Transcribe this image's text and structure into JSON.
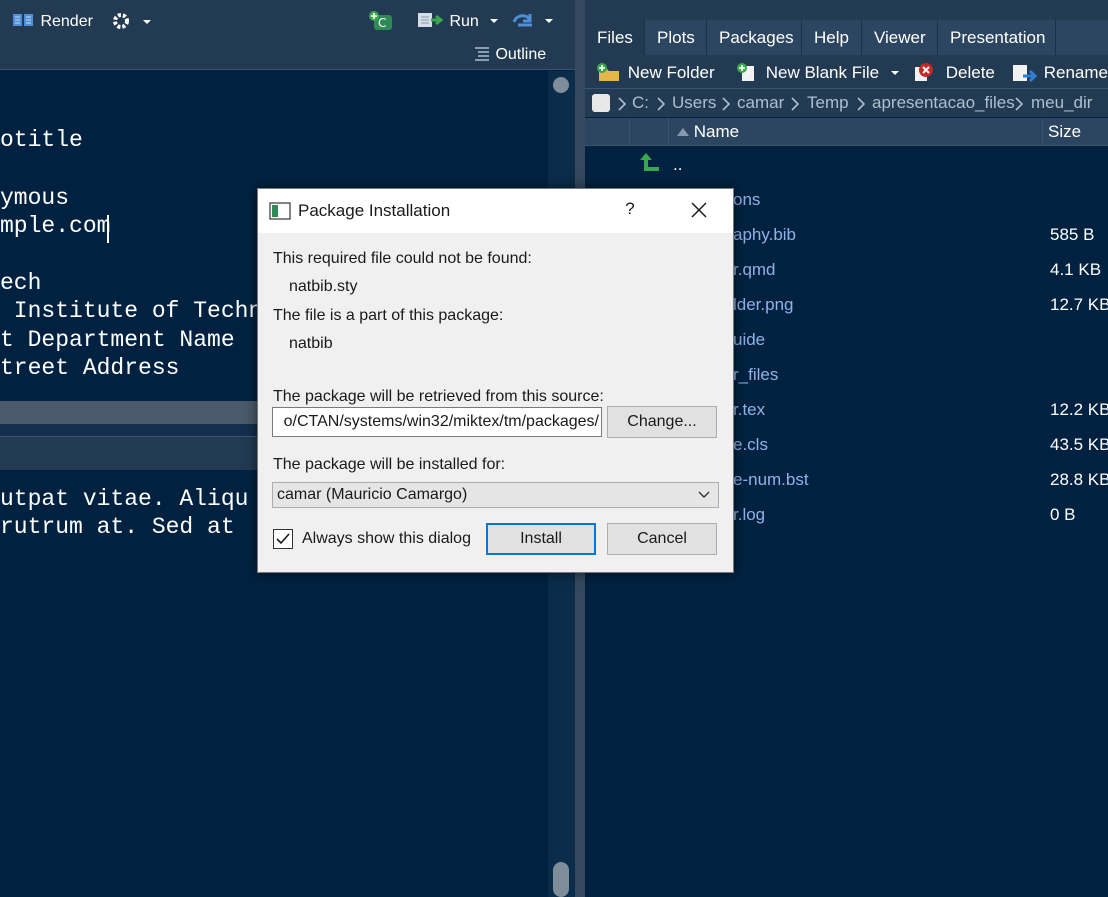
{
  "editor_toolbar": {
    "render_label": "Render",
    "run_label": "Run",
    "outline_label": "Outline"
  },
  "editor": {
    "lines": [
      "otitle",
      "ymous",
      "mple.com",
      "ech",
      " Institute of Techn",
      "t Department Name",
      "treet Address"
    ]
  },
  "console": {
    "lines": [
      "utpat vitae. Aliqu",
      "rutrum at. Sed at"
    ]
  },
  "right_tabs": [
    {
      "label": "Files",
      "active": true
    },
    {
      "label": "Plots"
    },
    {
      "label": "Packages"
    },
    {
      "label": "Help"
    },
    {
      "label": "Viewer"
    },
    {
      "label": "Presentation"
    }
  ],
  "files_toolbar": {
    "new_folder": "New Folder",
    "new_blank_file": "New Blank File",
    "delete": "Delete",
    "rename": "Rename"
  },
  "breadcrumb": [
    "C:",
    "Users",
    "camar",
    "Temp",
    "apresentacao_files",
    "meu_dir"
  ],
  "file_table": {
    "header_name": "Name",
    "header_size": "Size",
    "rows": [
      {
        "name": "..",
        "size": ""
      },
      {
        "name": "ons",
        "size": ""
      },
      {
        "name": "aphy.bib",
        "size": "585 B"
      },
      {
        "name": "r.qmd",
        "size": "4.1 KB"
      },
      {
        "name": "lder.png",
        "size": "12.7 KB"
      },
      {
        "name": "uide",
        "size": ""
      },
      {
        "name": "r_files",
        "size": ""
      },
      {
        "name": "r.tex",
        "size": "12.2 KB"
      },
      {
        "name": "e.cls",
        "size": "43.5 KB"
      },
      {
        "name": "e-num.bst",
        "size": "28.8 KB"
      },
      {
        "name": "r.log",
        "size": "0 B"
      }
    ]
  },
  "dialog": {
    "title": "Package Installation",
    "help": "?",
    "required_file_label": "This required file could not be found:",
    "required_file": "natbib.sty",
    "part_of_label": "The file is a part of this package:",
    "package": "natbib",
    "source_label": "The package will be retrieved from this source:",
    "source_value": "o/CTAN/systems/win32/miktex/tm/packages/",
    "change_button": "Change...",
    "installed_for_label": "The package will be installed for:",
    "installed_for_value": "camar (Mauricio Camargo)",
    "always_show_label": "Always show this dialog",
    "always_show_checked": true,
    "install_button": "Install",
    "cancel_button": "Cancel"
  },
  "colors": {
    "editor_bg": "#002240",
    "pane_bar": "#223a52",
    "file_link": "#8fb3e8",
    "dialog_bg": "#f0f0f0",
    "default_button_border": "#0078d7"
  }
}
